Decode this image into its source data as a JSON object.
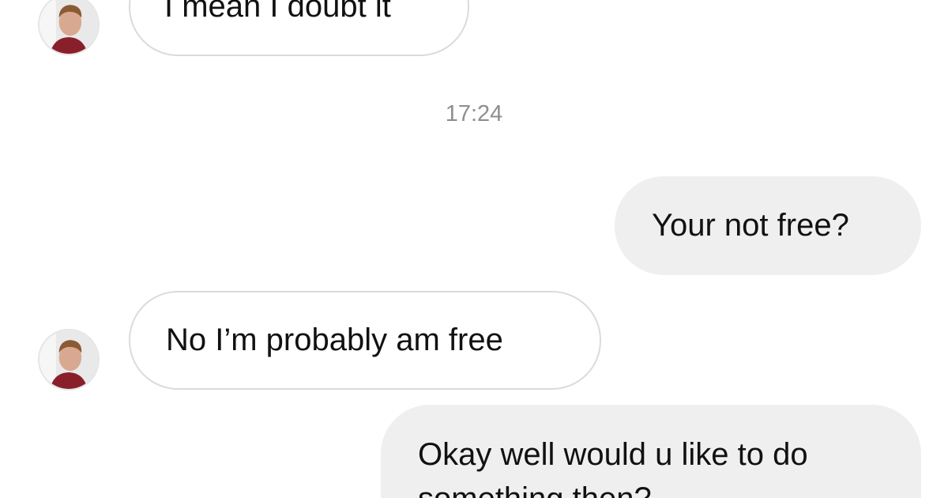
{
  "conversation": {
    "messages": [
      {
        "sender": "them",
        "text": "I mean I doubt it"
      },
      {
        "sender": "me",
        "text": "Your not free?"
      },
      {
        "sender": "them",
        "text": "No I’m probably am free"
      },
      {
        "sender": "me",
        "line1": "Okay well would u like to do",
        "line2": "something then?"
      }
    ],
    "timestamp": "17:24"
  },
  "colors": {
    "incoming_bubble_border": "#dbdbdb",
    "outgoing_bubble_fill": "#efefef",
    "timestamp_text": "#8e8e8e"
  },
  "icons": {
    "avatar": "profile-photo"
  }
}
